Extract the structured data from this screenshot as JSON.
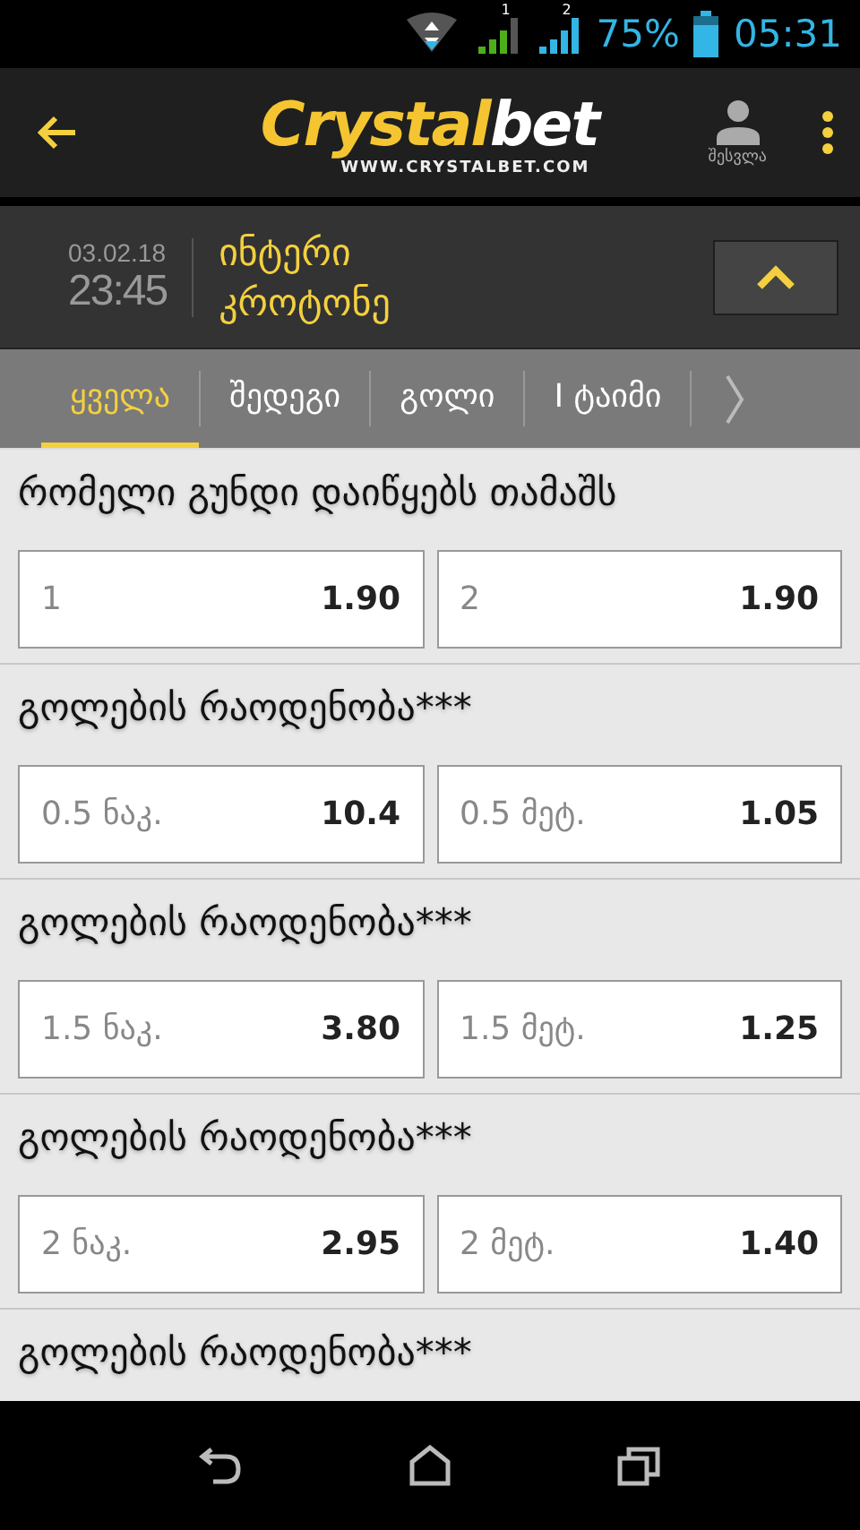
{
  "status_bar": {
    "sim_1": "1",
    "sim_2": "2",
    "battery": "75%",
    "time": "05:31"
  },
  "app_bar": {
    "logo": {
      "part_1": "Crystal",
      "part_2": "bet",
      "url": "WWW.CRYSTALBET.COM"
    },
    "login_label": "შესვლა"
  },
  "match": {
    "date": "03.02.18",
    "time": "23:45",
    "team_1": "ინტერი",
    "team_2": "კროტონე"
  },
  "tabs": [
    {
      "label": "ყველა",
      "selected": true
    },
    {
      "label": "შედეგი",
      "selected": false
    },
    {
      "label": "გოლი",
      "selected": false
    },
    {
      "label": "I ტაიმი",
      "selected": false
    }
  ],
  "markets": [
    {
      "title": "რომელი გუნდი დაიწყებს თამაშს",
      "odds": [
        {
          "label": "1",
          "value": "1.90"
        },
        {
          "label": "2",
          "value": "1.90"
        }
      ]
    },
    {
      "title": "გოლების რაოდენობა***",
      "odds": [
        {
          "label": "0.5 ნაკ.",
          "value": "10.4"
        },
        {
          "label": "0.5 მეტ.",
          "value": "1.05"
        }
      ]
    },
    {
      "title": "გოლების რაოდენობა***",
      "odds": [
        {
          "label": "1.5 ნაკ.",
          "value": "3.80"
        },
        {
          "label": "1.5 მეტ.",
          "value": "1.25"
        }
      ]
    },
    {
      "title": "გოლების რაოდენობა***",
      "odds": [
        {
          "label": "2 ნაკ.",
          "value": "2.95"
        },
        {
          "label": "2 მეტ.",
          "value": "1.40"
        }
      ]
    },
    {
      "title": "გოლების რაოდენობა***"
    }
  ]
}
